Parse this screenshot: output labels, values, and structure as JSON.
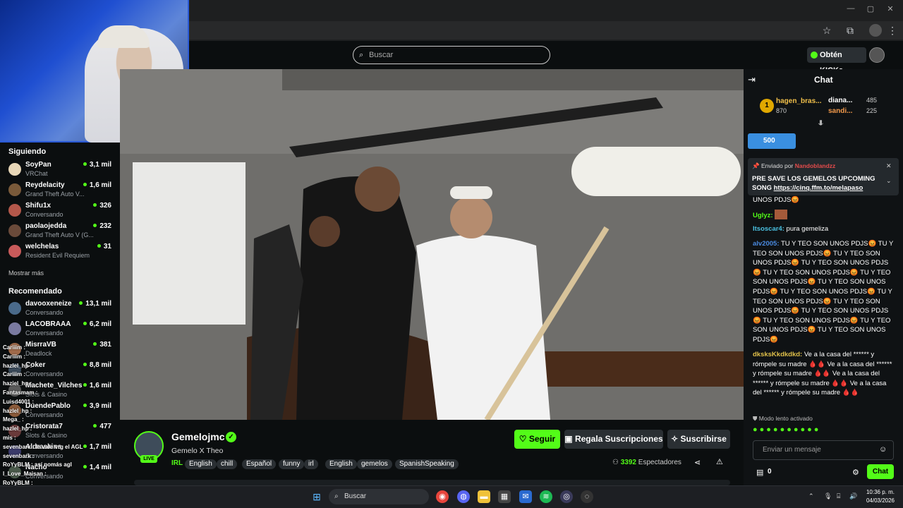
{
  "search": {
    "placeholder": "Buscar"
  },
  "header": {
    "kicks_label": "Obtén KICKs"
  },
  "sidebar": {
    "following_title": "Siguiendo",
    "following": [
      {
        "name": "SoyPan",
        "category": "VRChat",
        "viewers": "3,1 mil",
        "color": "#e8d7b8"
      },
      {
        "name": "Reydelacity",
        "category": "Grand Theft Auto V...",
        "viewers": "1,6 mil",
        "color": "#7a5a3a"
      },
      {
        "name": "Shifu1x",
        "category": "Conversando",
        "viewers": "326",
        "color": "#b3574a"
      },
      {
        "name": "paolaojedda",
        "category": "Grand Theft Auto V (G...",
        "viewers": "232",
        "color": "#6a4a3a"
      },
      {
        "name": "welchelas",
        "category": "Resident Evil Requiem",
        "viewers": "31",
        "color": "#c85a5a"
      }
    ],
    "show_more": "Mostrar más",
    "recommended_title": "Recomendado",
    "recommended": [
      {
        "name": "davooxeneize",
        "category": "Conversando",
        "viewers": "13,1 mil",
        "color": "#4a6a8a"
      },
      {
        "name": "LACOBRAAA",
        "category": "Conversando",
        "viewers": "6,2 mil",
        "color": "#7a7aa0"
      },
      {
        "name": "MisrraVB",
        "category": "Deadlock",
        "viewers": "381",
        "color": "#a06a4a"
      },
      {
        "name": "Coker",
        "category": "Conversando",
        "viewers": "8,8 mil",
        "color": "#3a4a5a"
      },
      {
        "name": "Machete_Vilches",
        "category": "Slots & Casino",
        "viewers": "1,6 mil",
        "color": "#5a5a5a"
      },
      {
        "name": "DuendePablo",
        "category": "Conversando",
        "viewers": "3,9 mil",
        "color": "#8a5a3a"
      },
      {
        "name": "Cristorata7",
        "category": "Slots & Casino",
        "viewers": "477",
        "color": "#6a3a3a"
      },
      {
        "name": "Aldraskins",
        "category": "Conversando",
        "viewers": "1,7 mil",
        "color": "#3a3a6a"
      },
      {
        "name": "Nacho",
        "category": "Conversando",
        "viewers": "1,4 mil",
        "color": "#4a5a4a"
      }
    ]
  },
  "overlay_chat": [
    "Cariiim :",
    "Cariiim :",
    "hazlel_hp :",
    "Cariiim :",
    "haziel_hp :",
    "Fantasmam :",
    "Luisd4001 :",
    "hazlel_hp :",
    "Mega_ :",
    "hazlel_hp :",
    "mis :",
    "sevenbark : le vale vrg el AGL",
    "sevenbark :",
    "RoYyBLM : así nomás agl",
    "l_Love_Maisan :",
    "RoYyBLM :"
  ],
  "streamer": {
    "name": "Gemelojmc",
    "title": "Gemelo X Theo",
    "live_badge": "LIVE",
    "category": "IRL",
    "tags": [
      "English",
      "chill",
      "Español",
      "funny",
      "irl",
      "English",
      "gemelos",
      "SpanishSpeaking"
    ],
    "viewers": "3392",
    "viewers_label": "Espectadores"
  },
  "actions": {
    "follow": "Seguir",
    "gift": "Regala Suscripciones",
    "subscribe": "Suscribirse"
  },
  "chat": {
    "title": "Chat",
    "leaderboard": [
      {
        "rank": "1",
        "name": "hagen_bras...",
        "value": "870"
      },
      {
        "name": "diana...",
        "value": "485"
      },
      {
        "name": "sandi...",
        "value": "225"
      }
    ],
    "kicks_pill": "500",
    "pinned_by_label": "Enviado por",
    "pinned_by_user": "Nandoblandzz",
    "pinned_text": "PRE SAVE LOS GEMELOS UPCOMING SONG",
    "pinned_link": "https://cinq.ffm.to/melapaso",
    "messages": [
      {
        "user": "",
        "text": "UNOS PDJS😡"
      },
      {
        "user": "Uglyz:",
        "text": ""
      },
      {
        "user": "Itsoscar4:",
        "text": " pura gemeliza"
      },
      {
        "user": "alv2005:",
        "text": " TU Y TEO SON UNOS PDJS😡 TU Y TEO SON UNOS PDJS😡 TU Y TEO SON UNOS PDJS😡 TU Y TEO SON UNOS PDJS😡 TU Y TEO SON UNOS PDJS😡 TU Y TEO SON UNOS PDJS😡 TU Y TEO SON UNOS PDJS😡 TU Y TEO SON UNOS PDJS😡 TU Y TEO SON UNOS PDJS😡 TU Y TEO SON UNOS PDJS😡 TU Y TEO SON UNOS PDJS😡 TU Y TEO SON UNOS PDJS😡 TU Y TEO SON UNOS PDJS😡 TU Y TEO SON UNOS PDJS😡"
      },
      {
        "user": "dksksKkdkdkd:",
        "text": " Ve a la casa del ****** y rómpele su madre 🩸🩸 Ve a la casa del ****** y rómpele su madre 🩸🩸 Ve a la casa del ****** y rómpele su madre 🩸🩸 Ve a la casa del ****** y rómpele su madre 🩸🩸"
      }
    ],
    "slow_mode": "Modo lento activado",
    "input_placeholder": "Enviar un mensaje",
    "points": "0",
    "send": "Chat"
  },
  "taskbar": {
    "search": "Buscar",
    "time": "10:36 p. m.",
    "date": "04/03/2026"
  },
  "colors": {
    "accent": "#53fc18",
    "background": "#0b0e0f"
  }
}
